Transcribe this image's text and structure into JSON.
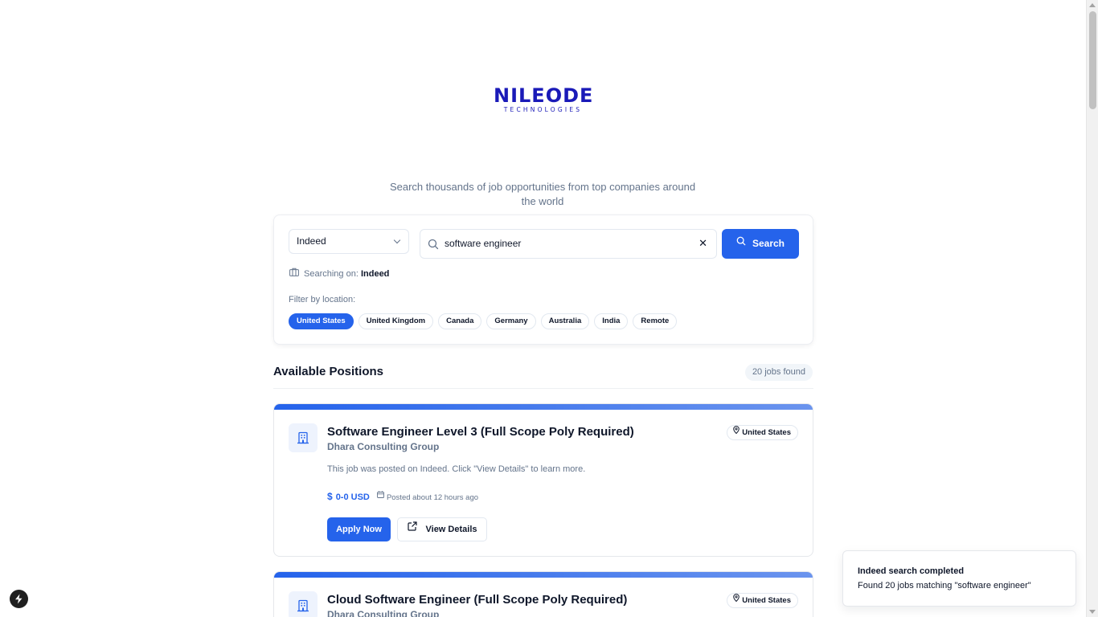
{
  "logo": {
    "main": "NILEODE",
    "sub": "TECHNOLOGIES"
  },
  "tagline": "Search thousands of job opportunities from top companies around the world",
  "search": {
    "source_selected": "Indeed",
    "query": "software engineer",
    "clear_glyph": "✕",
    "button_label": "Search",
    "searching_on_label": "Searching on:",
    "searching_on_value": "Indeed",
    "filter_label": "Filter by location:",
    "locations": [
      "United States",
      "United Kingdom",
      "Canada",
      "Germany",
      "Australia",
      "India",
      "Remote"
    ],
    "active_location": "United States"
  },
  "results": {
    "title": "Available Positions",
    "count": "20 jobs found",
    "jobs": [
      {
        "title": "Software Engineer Level 3 (Full Scope Poly Required)",
        "company": "Dhara Consulting Group",
        "location": "United States",
        "description": "This job was posted on Indeed. Click \"View Details\" to learn more.",
        "salary": "0-0 USD",
        "posted": "Posted about 12 hours ago",
        "apply_label": "Apply Now",
        "details_label": "View Details"
      },
      {
        "title": "Cloud Software Engineer (Full Scope Poly Required)",
        "company": "Dhara Consulting Group",
        "location": "United States"
      }
    ]
  },
  "toast": {
    "title": "Indeed search completed",
    "message": "Found 20 jobs matching \"software engineer\""
  },
  "colors": {
    "accent": "#2563eb",
    "muted": "#64748b",
    "text": "#0f172a",
    "logo": "#1a1ab8"
  }
}
